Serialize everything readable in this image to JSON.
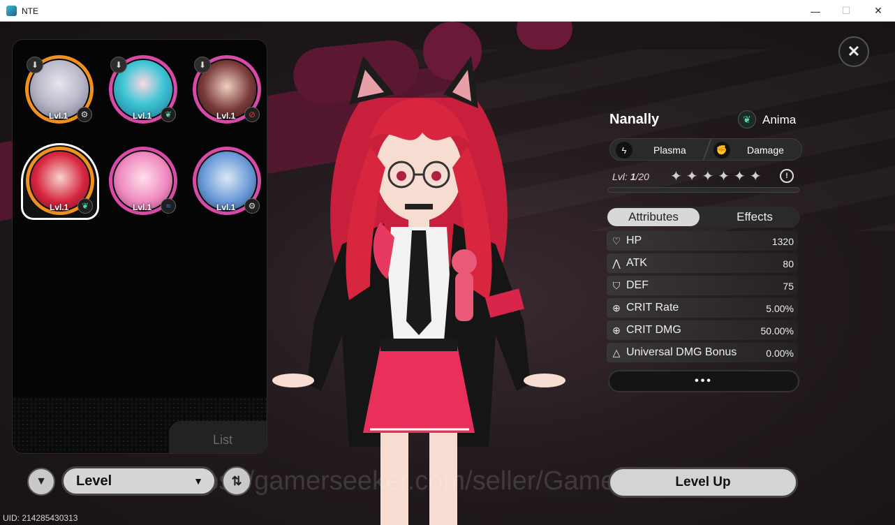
{
  "window": {
    "title": "NTE",
    "minimize_icon": "minimize-icon",
    "maximize_icon": "maximize-icon",
    "close_icon": "close-icon"
  },
  "roster": {
    "characters": [
      {
        "level": "Lvl.1",
        "ring_color": "#f0901e",
        "element_icon": "gear-icon",
        "has_download": true
      },
      {
        "level": "Lvl.1",
        "ring_color": "#d84aa8",
        "element_icon": "leaf-icon",
        "has_download": true
      },
      {
        "level": "Lvl.1",
        "ring_color": "#d84aa8",
        "element_icon": "no-entry-icon",
        "has_download": true
      },
      {
        "level": "Lvl.1",
        "ring_color": "#f0901e",
        "element_icon": "leaf-icon",
        "has_download": false,
        "selected": true
      },
      {
        "level": "Lvl.1",
        "ring_color": "#d84aa8",
        "element_icon": "wave-icon",
        "has_download": false
      },
      {
        "level": "Lvl.1",
        "ring_color": "#d84aa8",
        "element_icon": "gear-icon",
        "has_download": false
      }
    ],
    "list_label": "List"
  },
  "controls": {
    "sort_label": "Level",
    "watermark": "https://gamerseeker.com/seller/GameNation"
  },
  "uid": "UID: 214285430313",
  "character": {
    "name": "Nanally",
    "element": "Anima",
    "attack_type": "Plasma",
    "role": "Damage",
    "level_prefix": "Lvl: ",
    "level_current": "1",
    "level_max": "/20",
    "stars": "✦✦✦✦✦✦"
  },
  "tabs": {
    "attributes": "Attributes",
    "effects": "Effects"
  },
  "stats": [
    {
      "name": "HP",
      "value": "1320",
      "icon": "heart-icon"
    },
    {
      "name": "ATK",
      "value": "80",
      "icon": "atk-icon"
    },
    {
      "name": "DEF",
      "value": "75",
      "icon": "shield-icon"
    },
    {
      "name": "CRIT Rate",
      "value": "5.00%",
      "icon": "crosshair-icon"
    },
    {
      "name": "CRIT DMG",
      "value": "50.00%",
      "icon": "crosshair-icon"
    },
    {
      "name": "Universal DMG Bonus",
      "value": "0.00%",
      "icon": "triangle-icon"
    }
  ],
  "more_label": "•••",
  "level_up_label": "Level Up"
}
